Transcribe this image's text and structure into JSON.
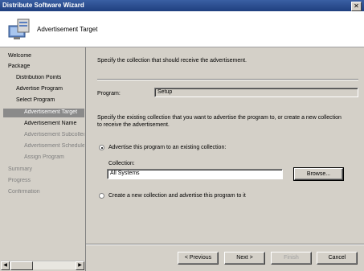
{
  "window": {
    "title": "Distribute Software Wizard",
    "close_label": "✕"
  },
  "header": {
    "title": "Advertisement Target",
    "icon": "computer-software-icon"
  },
  "nav": {
    "welcome": "Welcome",
    "package": "Package",
    "distribution_points": "Distribution Points",
    "advertise_program": "Advertise Program",
    "select_program": "Select Program",
    "advertisement_target": "Advertisement Target",
    "advertisement_name": "Advertisement Name",
    "advertisement_subcollection": "Advertisement Subcollec",
    "advertisement_schedule": "Advertisement Schedule",
    "assign_program": "Assign Program",
    "summary": "Summary",
    "progress": "Progress",
    "confirmation": "Confirmation"
  },
  "main": {
    "intro": "Specify the collection that should receive the advertisement.",
    "program_label": "Program:",
    "program_value": "Setup",
    "description_line1": "Specify the existing collection that you want to advertise the program to, or create a new collection",
    "description_line2": "to receive the advertisement.",
    "radio_existing_label": "Advertise this program to an existing collection:",
    "collection_label": "Collection:",
    "collection_value": "All Systems",
    "browse_label": "Browse...",
    "radio_new_label": "Create a new collection and advertise this program to it"
  },
  "footer": {
    "previous_label": "< Previous",
    "next_label": "Next >",
    "finish_label": "Finish",
    "cancel_label": "Cancel"
  },
  "colors": {
    "title_bar": "#1f3f7f",
    "selected_nav": "#8a8a8a",
    "dialog_face": "#d4d0c8"
  }
}
